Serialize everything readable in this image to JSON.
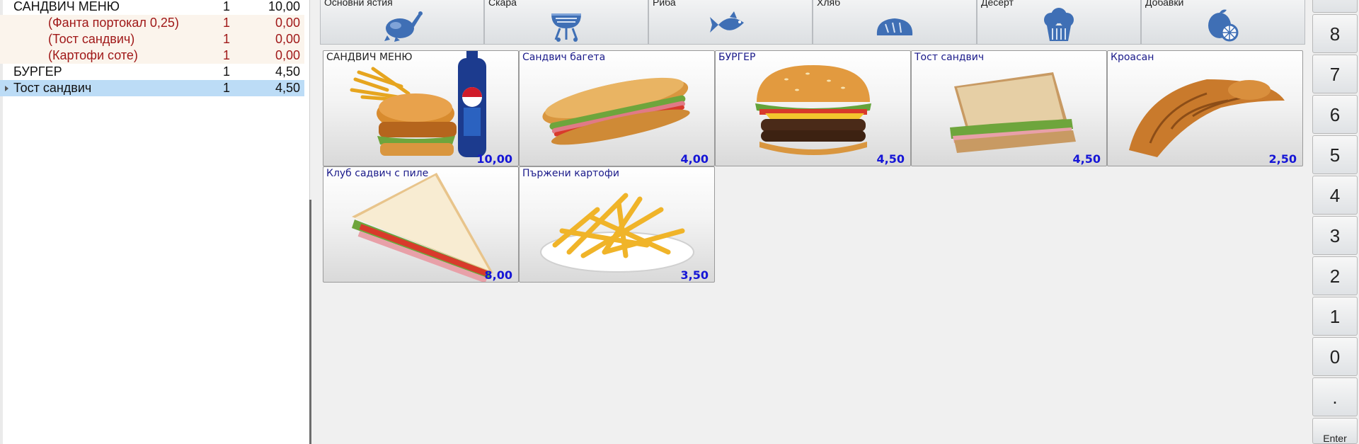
{
  "order": {
    "rows": [
      {
        "name": "САНДВИЧ МЕНЮ",
        "qty": "1",
        "price": "10,00",
        "kind": "main"
      },
      {
        "name": "(Фанта портокал 0,25)",
        "qty": "1",
        "price": "0,00",
        "kind": "sub"
      },
      {
        "name": "(Тост сандвич)",
        "qty": "1",
        "price": "0,00",
        "kind": "sub"
      },
      {
        "name": "(Картофи соте)",
        "qty": "1",
        "price": "0,00",
        "kind": "sub"
      },
      {
        "name": "БУРГЕР",
        "qty": "1",
        "price": "4,50",
        "kind": "main"
      },
      {
        "name": "Тост сандвич",
        "qty": "1",
        "price": "4,50",
        "kind": "selected"
      }
    ]
  },
  "categories": [
    {
      "label": "Основни ястия",
      "icon": "roast-chicken-icon"
    },
    {
      "label": "Скара",
      "icon": "grill-icon"
    },
    {
      "label": "Риба",
      "icon": "fish-icon"
    },
    {
      "label": "Хляб",
      "icon": "bread-icon"
    },
    {
      "label": "Десерт",
      "icon": "cupcake-icon"
    },
    {
      "label": "Добавки",
      "icon": "lemon-icon"
    }
  ],
  "products": [
    {
      "name": "САНДВИЧ МЕНЮ",
      "price": "10,00",
      "image": "menu-combo"
    },
    {
      "name": "Сандвич багета",
      "price": "4,00",
      "image": "baguette"
    },
    {
      "name": "БУРГЕР",
      "price": "4,50",
      "image": "burger"
    },
    {
      "name": "Тост сандвич",
      "price": "4,50",
      "image": "toast"
    },
    {
      "name": "Кроасан",
      "price": "2,50",
      "image": "croissant"
    },
    {
      "name": "Клуб садвич с пиле",
      "price": "8,00",
      "image": "club"
    },
    {
      "name": "Пържени картофи",
      "price": "3,50",
      "image": "fries"
    }
  ],
  "numpad": {
    "keys": [
      "8",
      "7",
      "6",
      "5",
      "4",
      "3",
      "2",
      "1",
      "0",
      ".",
      "Enter"
    ]
  },
  "colors": {
    "sub_text": "#a01919",
    "selected_row": "#bcdcf6",
    "price_blue": "#1515d6",
    "icon_blue": "#3f6fb5"
  }
}
